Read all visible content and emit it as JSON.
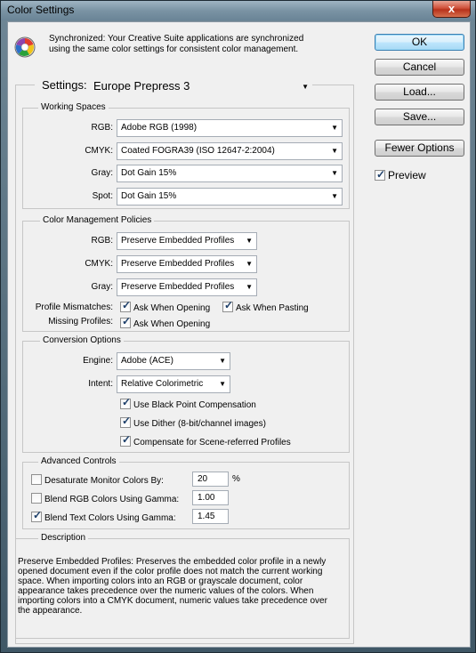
{
  "window": {
    "title": "Color Settings",
    "close_glyph": "x"
  },
  "sync": {
    "icon": "sync-color-wheel-icon",
    "line1": "Synchronized: Your Creative Suite applications are synchronized",
    "line2": "using the same color settings for consistent color management."
  },
  "buttons": {
    "ok": "OK",
    "cancel": "Cancel",
    "load": "Load...",
    "save": "Save...",
    "fewer": "Fewer Options"
  },
  "preview": {
    "label": "Preview",
    "checked": true
  },
  "settings": {
    "label": "Settings:",
    "value": "Europe Prepress 3"
  },
  "working_spaces": {
    "title": "Working Spaces",
    "rows": [
      {
        "label": "RGB:",
        "value": "Adobe RGB (1998)"
      },
      {
        "label": "CMYK:",
        "value": "Coated FOGRA39 (ISO 12647-2:2004)"
      },
      {
        "label": "Gray:",
        "value": "Dot Gain 15%"
      },
      {
        "label": "Spot:",
        "value": "Dot Gain 15%"
      }
    ]
  },
  "policies": {
    "title": "Color Management Policies",
    "rows": [
      {
        "label": "RGB:",
        "value": "Preserve Embedded Profiles"
      },
      {
        "label": "CMYK:",
        "value": "Preserve Embedded Profiles"
      },
      {
        "label": "Gray:",
        "value": "Preserve Embedded Profiles"
      }
    ],
    "mismatch_label": "Profile Mismatches:",
    "mismatch_open": "Ask When Opening",
    "mismatch_paste": "Ask When Pasting",
    "missing_label": "Missing Profiles:",
    "missing_open": "Ask When Opening"
  },
  "conversion": {
    "title": "Conversion Options",
    "engine_label": "Engine:",
    "engine_value": "Adobe (ACE)",
    "intent_label": "Intent:",
    "intent_value": "Relative Colorimetric",
    "bpc": "Use Black Point Compensation",
    "dither": "Use Dither (8-bit/channel images)",
    "scene": "Compensate for Scene-referred Profiles"
  },
  "advanced": {
    "title": "Advanced Controls",
    "desaturate_label": "Desaturate Monitor Colors By:",
    "desaturate_value": "20",
    "desaturate_unit": "%",
    "desaturate_checked": false,
    "blend_rgb_label": "Blend RGB Colors Using Gamma:",
    "blend_rgb_value": "1.00",
    "blend_rgb_checked": false,
    "blend_text_label": "Blend Text Colors Using Gamma:",
    "blend_text_value": "1.45",
    "blend_text_checked": true
  },
  "description": {
    "title": "Description",
    "text": "Preserve Embedded Profiles:  Preserves the embedded color profile in a newly opened document even if the color profile does not match the current working space.  When importing colors into an RGB or grayscale document, color appearance takes precedence over the numeric values of the colors.  When importing colors into a CMYK document, numeric values take precedence over the appearance."
  },
  "colors": {
    "accent_border": "#3c7fb1",
    "close_red": "#c7402a",
    "panel_bg": "#f0f0f0"
  }
}
